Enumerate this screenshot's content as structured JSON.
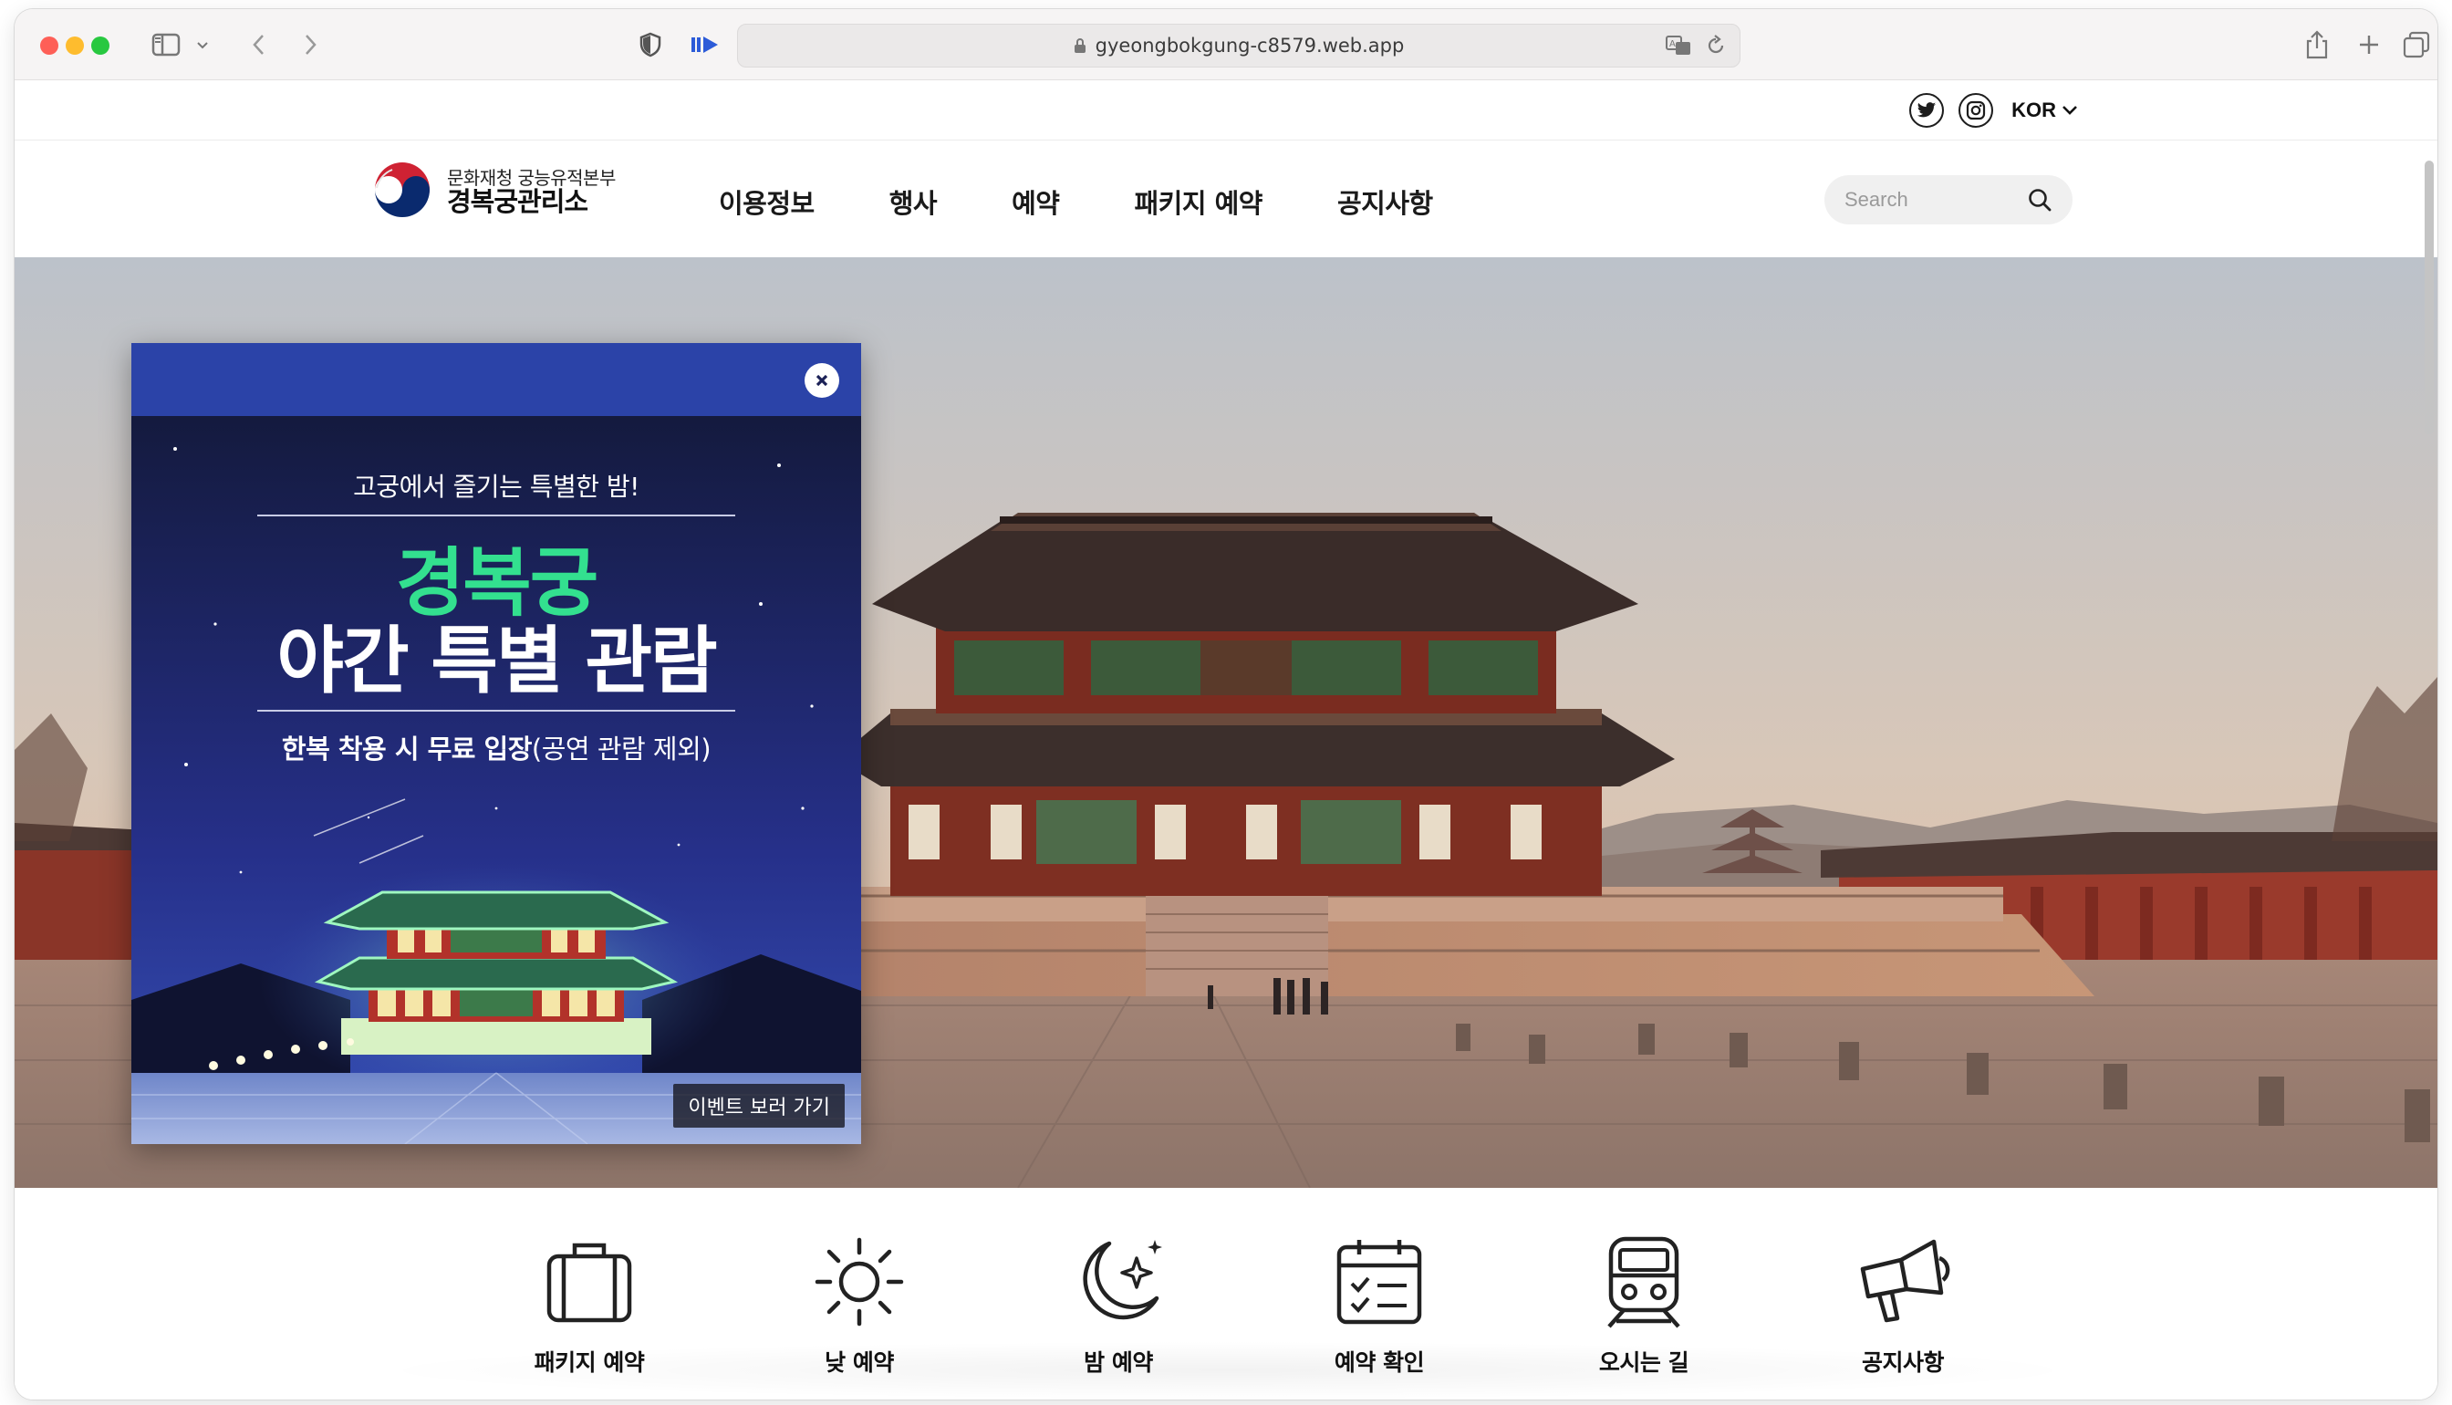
{
  "browser": {
    "url": "gyeongbokgung-c8579.web.app"
  },
  "utility": {
    "language": "KOR",
    "icons": [
      "twitter-icon",
      "instagram-icon"
    ]
  },
  "logo": {
    "sub": "문화재청 궁능유적본부",
    "main": "경복궁관리소"
  },
  "menu": [
    {
      "label": "이용정보"
    },
    {
      "label": "행사"
    },
    {
      "label": "예약"
    },
    {
      "label": "패키지 예약"
    },
    {
      "label": "공지사항"
    }
  ],
  "search": {
    "placeholder": "Search"
  },
  "popup": {
    "tagline": "고궁에서 즐기는 특별한 밤!",
    "title_green": "경복궁",
    "title_white": "야간 특별 관람",
    "note_bold": "한복 착용 시 무료 입장",
    "note_rest": "(공연 관람 제외)",
    "cta": "이벤트 보러 가기"
  },
  "quick_menu": [
    {
      "label": "패키지 예약",
      "icon": "luggage-icon"
    },
    {
      "label": "낮 예약",
      "icon": "sun-icon"
    },
    {
      "label": "밤 예약",
      "icon": "moon-icon"
    },
    {
      "label": "예약 확인",
      "icon": "calendar-check-icon"
    },
    {
      "label": "오시는 길",
      "icon": "train-icon"
    },
    {
      "label": "공지사항",
      "icon": "megaphone-icon"
    }
  ],
  "colors": {
    "popup_header": "#2b43a8",
    "popup_bg": "#1b2156",
    "accent_green": "#33e08f"
  }
}
